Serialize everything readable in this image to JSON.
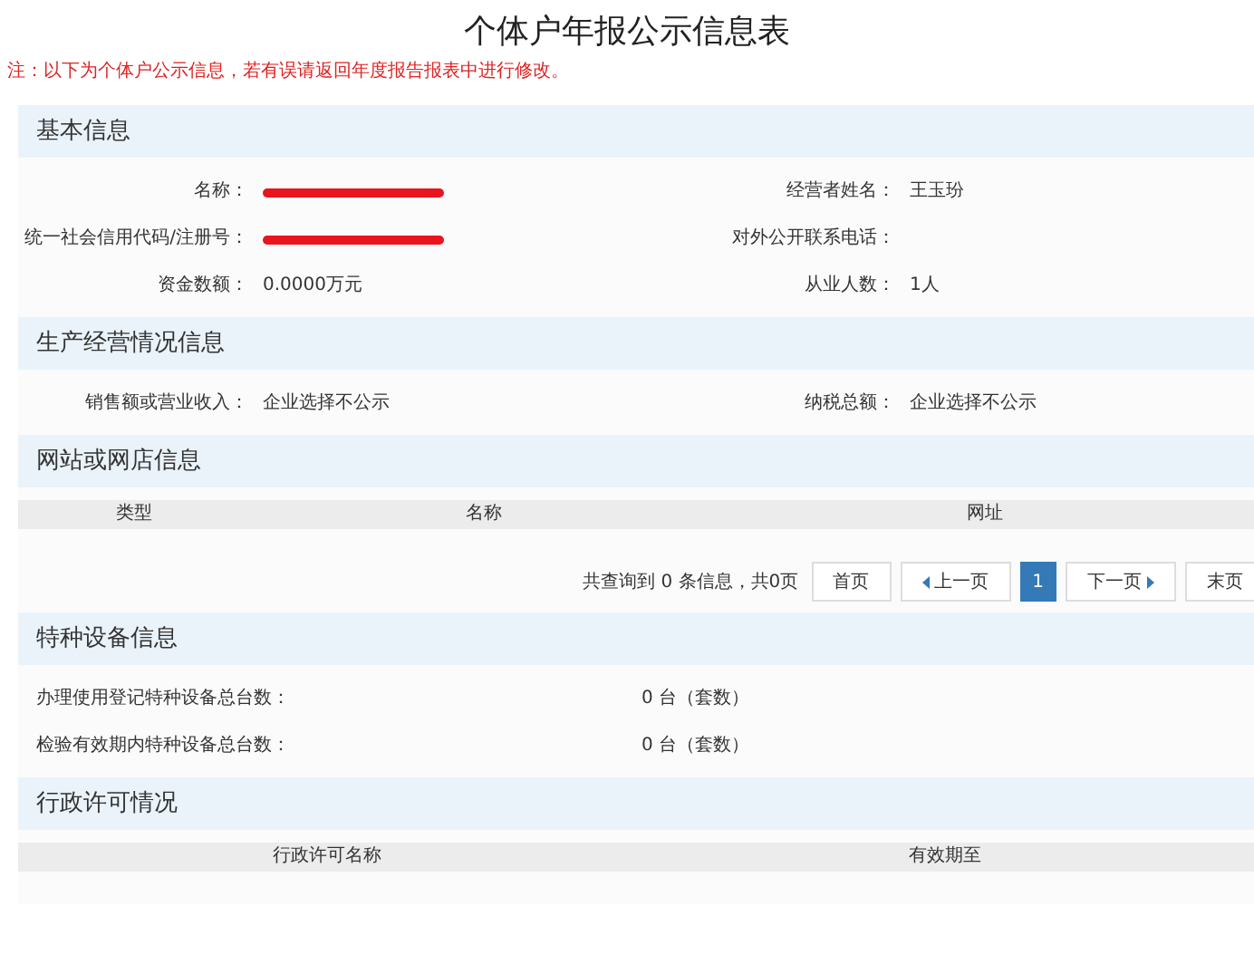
{
  "title": "个体户年报公示信息表",
  "note": "注：以下为个体户公示信息，若有误请返回年度报告报表中进行修改。",
  "sections": [
    {
      "kind": "fields",
      "heading": "基本信息",
      "rows": [
        {
          "left": {
            "label": "名称：",
            "redacted": true
          },
          "right": {
            "label": "经营者姓名：",
            "value": "王玉玢"
          }
        },
        {
          "left": {
            "label": "统一社会信用代码/注册号：",
            "redacted": true
          },
          "right": {
            "label": "对外公开联系电话："
          }
        },
        {
          "left": {
            "label": "资金数额：",
            "value": "0.0000万元"
          },
          "right": {
            "label": "从业人数：",
            "value": "1人"
          }
        }
      ]
    },
    {
      "kind": "fields",
      "heading": "生产经营情况信息",
      "rows": [
        {
          "left": {
            "label": "销售额或营业收入：",
            "value": "企业选择不公示"
          },
          "right": {
            "label": "纳税总额：",
            "value": "企业选择不公示"
          }
        }
      ]
    },
    {
      "kind": "table",
      "heading": "网站或网店信息",
      "columns": [
        "类型",
        "名称",
        "网址"
      ],
      "pager": {
        "summary": "共查询到 0 条信息，共0页",
        "buttons": [
          {
            "kind": "text",
            "label": "首页",
            "selected": false
          },
          {
            "kind": "prev",
            "label": "上一页",
            "selected": false
          },
          {
            "kind": "text",
            "label": "1",
            "selected": true
          },
          {
            "kind": "next",
            "label": "下一页",
            "selected": false
          },
          {
            "kind": "text",
            "label": "末页",
            "selected": false
          }
        ]
      }
    },
    {
      "kind": "list",
      "heading": "特种设备信息",
      "rows": [
        {
          "label": "办理使用登记特种设备总台数：",
          "value": "0 台（套数）"
        },
        {
          "label": "检验有效期内特种设备总台数：",
          "value": "0 台（套数）"
        }
      ]
    },
    {
      "kind": "table",
      "heading": "行政许可情况",
      "columns": [
        "行政许可名称",
        "有效期至"
      ]
    }
  ]
}
